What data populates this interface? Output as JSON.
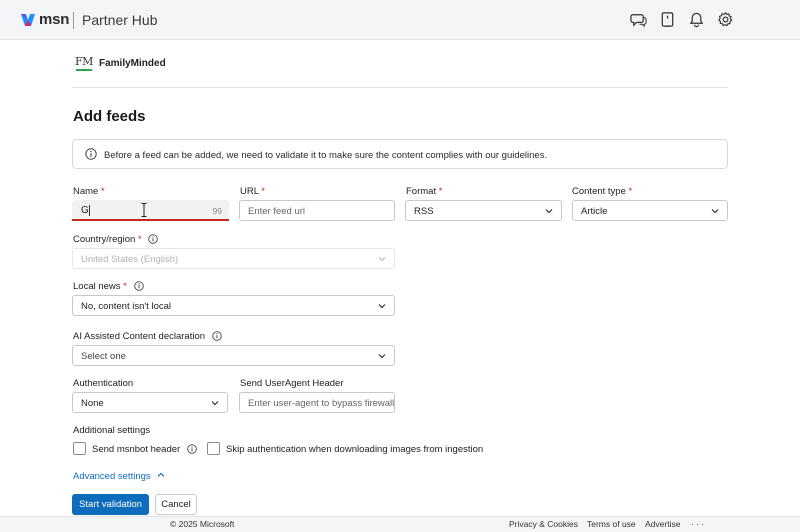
{
  "header": {
    "brand": "msn",
    "product": "Partner Hub",
    "icons": [
      "feedback-icon",
      "notebook-icon",
      "bell-icon",
      "gear-icon"
    ]
  },
  "account": {
    "logo_text": "FM",
    "name": "FamilyMinded"
  },
  "page": {
    "title": "Add feeds",
    "info": "Before a feed can be added, we need to validate it to make sure the content complies with our guidelines."
  },
  "form": {
    "name": {
      "label": "Name",
      "required": "*",
      "value": "G",
      "count": "99"
    },
    "url": {
      "label": "URL",
      "required": "*",
      "placeholder": "Enter feed url"
    },
    "format": {
      "label": "Format",
      "required": "*",
      "value": "RSS"
    },
    "content_type": {
      "label": "Content type",
      "required": "*",
      "value": "Article"
    },
    "country": {
      "label": "Country/region",
      "required": "*",
      "value": "United States (English)"
    },
    "local_news": {
      "label": "Local news",
      "required": "*",
      "value": "No, content isn't local"
    },
    "ai_content": {
      "label": "AI Assisted Content declaration",
      "placeholder": "Select one"
    },
    "authentication": {
      "label": "Authentication",
      "value": "None"
    },
    "user_agent": {
      "label": "Send UserAgent Header",
      "placeholder": "Enter user-agent to bypass firewall"
    },
    "additional": {
      "label": "Additional settings",
      "send_msnbot": "Send msnbot header",
      "skip_auth": "Skip authentication when downloading images from ingestion"
    },
    "advanced_link": "Advanced settings",
    "start_button": "Start validation",
    "cancel_button": "Cancel"
  },
  "footer": {
    "copyright": "© 2025 Microsoft",
    "privacy": "Privacy & Cookies",
    "terms": "Terms of use",
    "advertise": "Advertise",
    "more": "· · ·"
  },
  "colors": {
    "accent": "#0f6cbd",
    "required": "#c42b1c",
    "header_bg": "#f4f5f6"
  }
}
